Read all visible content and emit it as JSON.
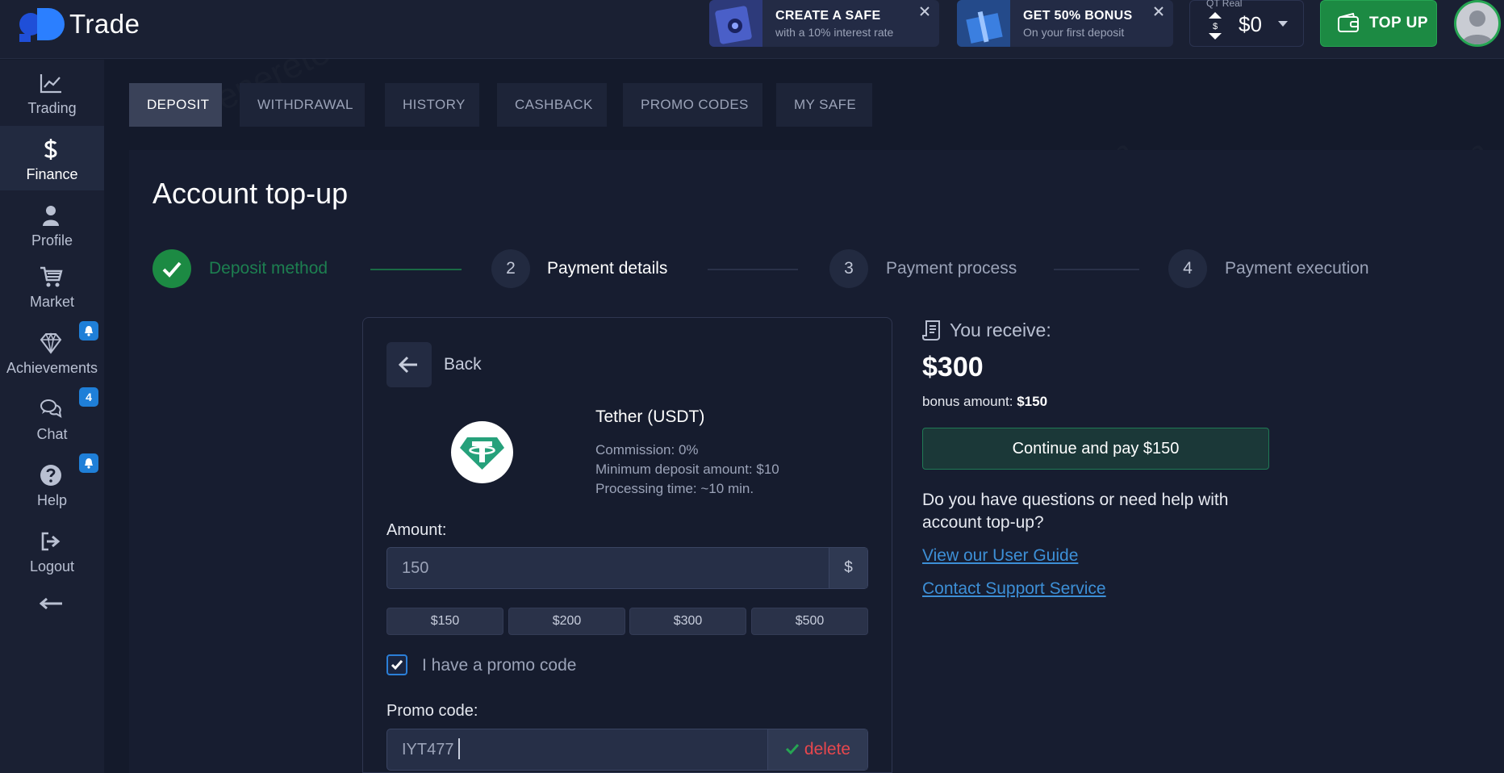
{
  "brand": {
    "name": "Trade"
  },
  "promos": [
    {
      "title": "CREATE A SAFE",
      "subtitle": "with a 10% interest rate"
    },
    {
      "title": "GET 50% BONUS",
      "subtitle": "On your first deposit"
    }
  ],
  "account": {
    "type_label": "QT Real",
    "currency_symbol": "$",
    "balance": "$0"
  },
  "topup": {
    "label": "TOP UP"
  },
  "sidebar": {
    "items": [
      {
        "label": "Trading"
      },
      {
        "label": "Finance"
      },
      {
        "label": "Profile"
      },
      {
        "label": "Market"
      },
      {
        "label": "Achievements"
      },
      {
        "label": "Chat",
        "badge": "4"
      },
      {
        "label": "Help"
      },
      {
        "label": "Logout"
      }
    ]
  },
  "tabs": [
    {
      "label": "DEPOSIT"
    },
    {
      "label": "WITHDRAWAL"
    },
    {
      "label": "HISTORY"
    },
    {
      "label": "CASHBACK"
    },
    {
      "label": "PROMO CODES"
    },
    {
      "label": "MY SAFE"
    }
  ],
  "page": {
    "title": "Account top-up"
  },
  "steps": [
    {
      "label": "Deposit method"
    },
    {
      "number": "2",
      "label": "Payment details"
    },
    {
      "number": "3",
      "label": "Payment process"
    },
    {
      "number": "4",
      "label": "Payment execution"
    }
  ],
  "form": {
    "back_label": "Back",
    "method_name": "Tether (USDT)",
    "commission": "Commission: 0%",
    "min_deposit": "Minimum deposit amount: $10",
    "processing": "Processing time: ~10 min.",
    "amount_label": "Amount:",
    "amount_value": "150",
    "amount_suffix": "$",
    "quick_amounts": [
      "$150",
      "$200",
      "$300",
      "$500"
    ],
    "promo_checkbox_label": "I have a promo code",
    "promo_label": "Promo code:",
    "promo_value": "IYT477",
    "delete_label": "delete"
  },
  "summary": {
    "receive_label": "You receive:",
    "receive_amount": "$300",
    "bonus_prefix": "bonus amount:",
    "bonus_value": "$150",
    "continue_label": "Continue and pay $150",
    "help_question": "Do you have questions or need help with account top-up?",
    "guide_link": "View our User Guide",
    "support_link": "Contact Support Service"
  },
  "colors": {
    "accent_green": "#1c8a43",
    "link_blue": "#3d8fd6",
    "delete_red": "#e8474d",
    "badge_blue": "#1f7fd8"
  }
}
